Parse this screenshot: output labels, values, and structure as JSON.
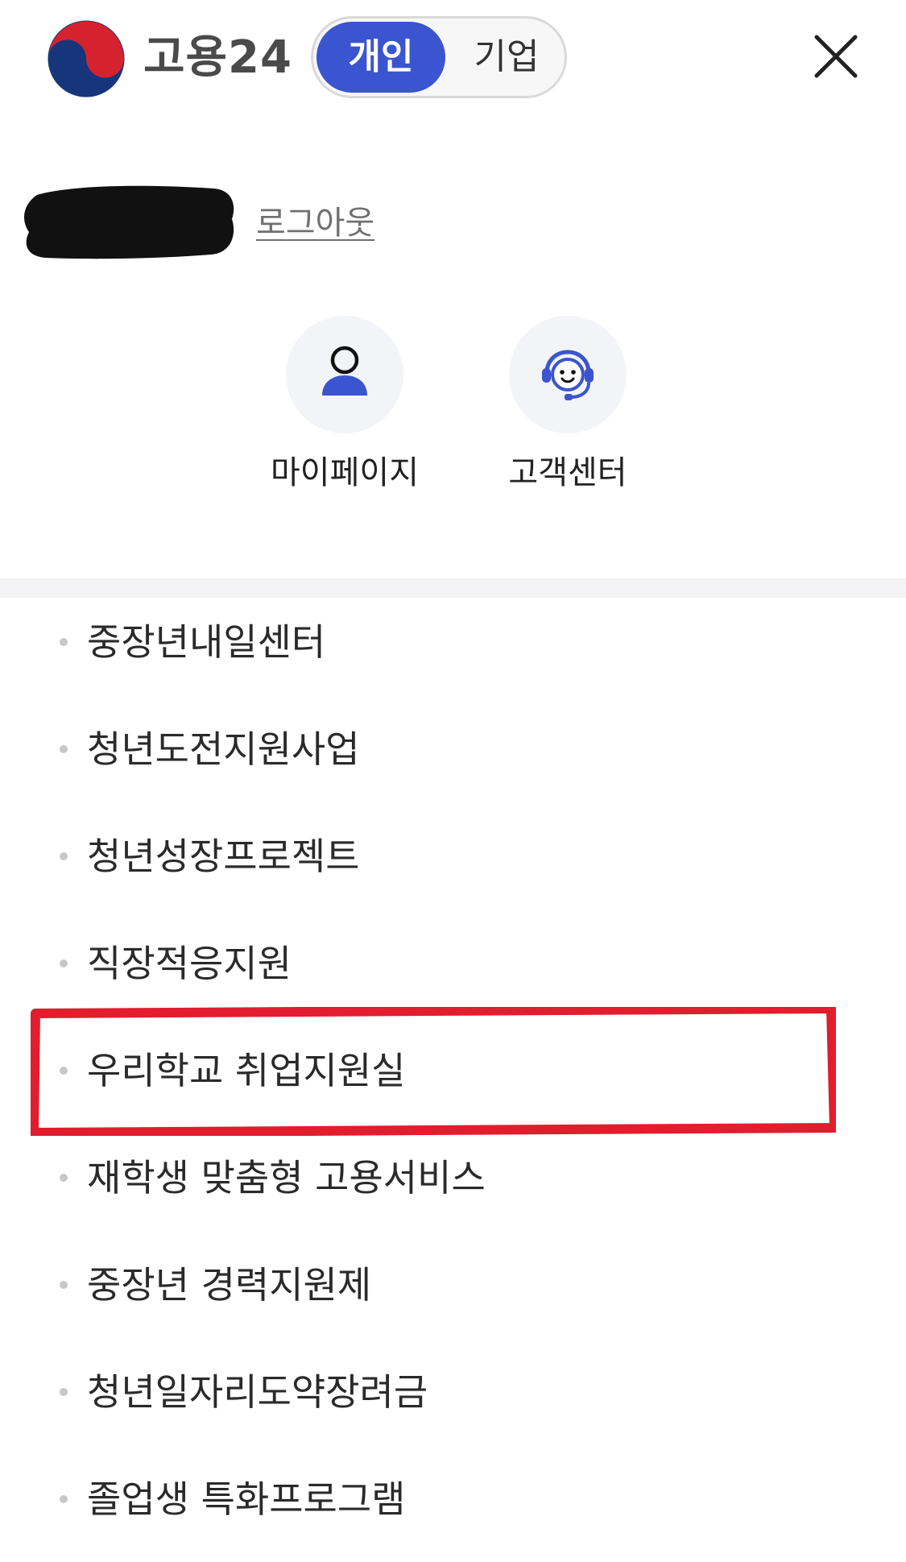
{
  "header": {
    "logo_text": "고용24",
    "toggle": {
      "personal_label": "개인",
      "company_label": "기업",
      "selected": "personal"
    },
    "close_icon": "close-icon"
  },
  "user": {
    "logout_label": "로그아웃"
  },
  "shortcuts": [
    {
      "label": "마이페이지",
      "icon": "person-icon"
    },
    {
      "label": "고객센터",
      "icon": "headset-icon"
    }
  ],
  "menu": {
    "items": [
      {
        "label": "중장년내일센터"
      },
      {
        "label": "청년도전지원사업"
      },
      {
        "label": "청년성장프로젝트"
      },
      {
        "label": "직장적응지원"
      },
      {
        "label": "우리학교 취업지원실",
        "highlighted": true
      },
      {
        "label": "재학생 맞춤형 고용서비스"
      },
      {
        "label": "중장년 경력지원제"
      },
      {
        "label": "청년일자리도약장려금"
      },
      {
        "label": "졸업생 특화프로그램"
      }
    ]
  },
  "colors": {
    "accent": "#3a55cf",
    "highlight": "#e11d2e",
    "divider": "#f3f3f5"
  }
}
